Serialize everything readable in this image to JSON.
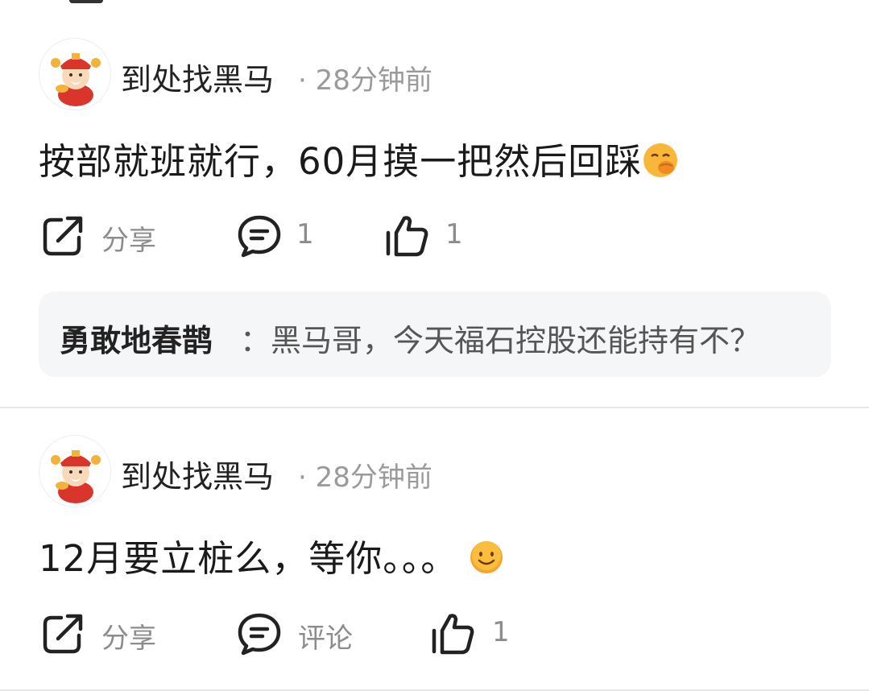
{
  "posts": [
    {
      "author": "到处找黑马",
      "time": "· 28分钟前",
      "content": "按部就班就行，60月摸一把然后回踩",
      "content_emoji": "hand-over-mouth-emoji",
      "actions": {
        "share_label": "分享",
        "comment_label": "1",
        "like_count": "1"
      },
      "reply": {
        "user": "勇敢地春鹊",
        "text": "：黑马哥，今天福石控股还能持有不？"
      }
    },
    {
      "author": "到处找黑马",
      "time": "· 28分钟前",
      "content": "12月要立桩么，等你。。。",
      "content_emoji": "smiling-face-emoji",
      "actions": {
        "share_label": "分享",
        "comment_label": "评论",
        "like_count": "1"
      }
    }
  ],
  "icons": {
    "share": "share-icon",
    "comment": "comment-icon",
    "like": "thumbs-up-icon",
    "avatar": "caishen-avatar"
  },
  "colors": {
    "text": "#1a1a1a",
    "muted": "#8c8c8c",
    "reply_bg": "#f5f6f7",
    "divider": "#e6e6e6"
  }
}
